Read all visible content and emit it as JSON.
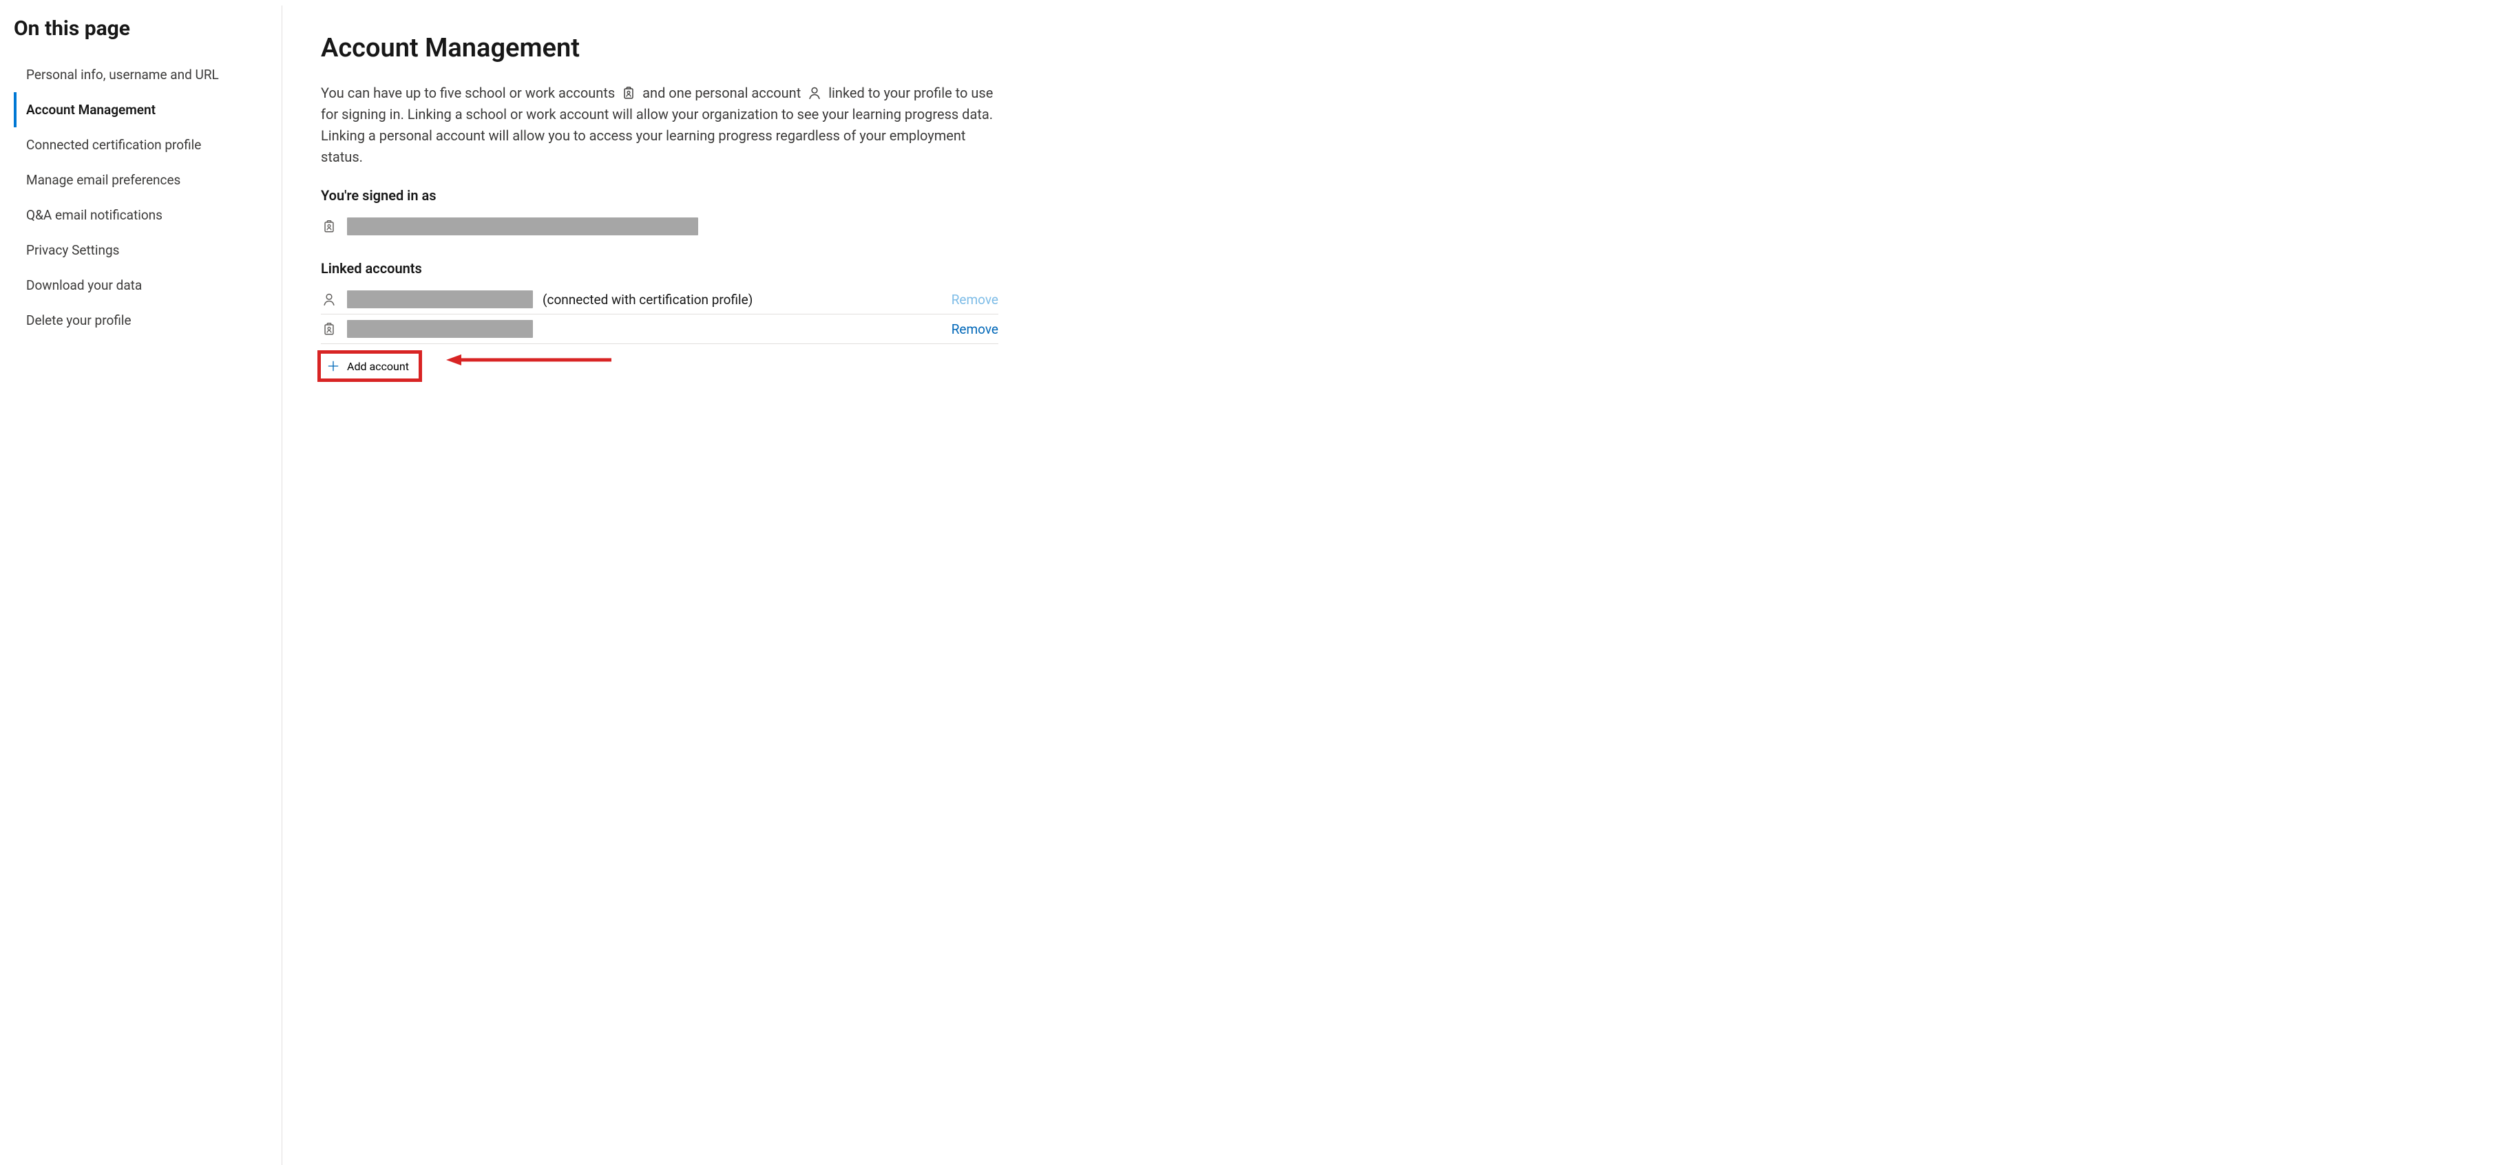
{
  "sidebar": {
    "title": "On this page",
    "items": [
      {
        "label": "Personal info, username and URL",
        "active": false
      },
      {
        "label": "Account Management",
        "active": true
      },
      {
        "label": "Connected certification profile",
        "active": false
      },
      {
        "label": "Manage email preferences",
        "active": false
      },
      {
        "label": "Q&A email notifications",
        "active": false
      },
      {
        "label": "Privacy Settings",
        "active": false
      },
      {
        "label": "Download your data",
        "active": false
      },
      {
        "label": "Delete your profile",
        "active": false
      }
    ]
  },
  "main": {
    "title": "Account Management",
    "intro_part1": "You can have up to five school or work accounts ",
    "intro_part2": " and one personal account ",
    "intro_part3": " linked to your profile to use for signing in. Linking a school or work account will allow your organization to see your learning progress data. Linking a personal account will allow you to access your learning progress regardless of your employment status.",
    "signed_in_label": "You're signed in as",
    "linked_label": "Linked accounts",
    "linked": [
      {
        "icon": "person",
        "note": "(connected with certification profile)",
        "remove_label": "Remove",
        "remove_enabled": false
      },
      {
        "icon": "badge",
        "note": "",
        "remove_label": "Remove",
        "remove_enabled": true
      }
    ],
    "add_account_label": "Add account"
  }
}
